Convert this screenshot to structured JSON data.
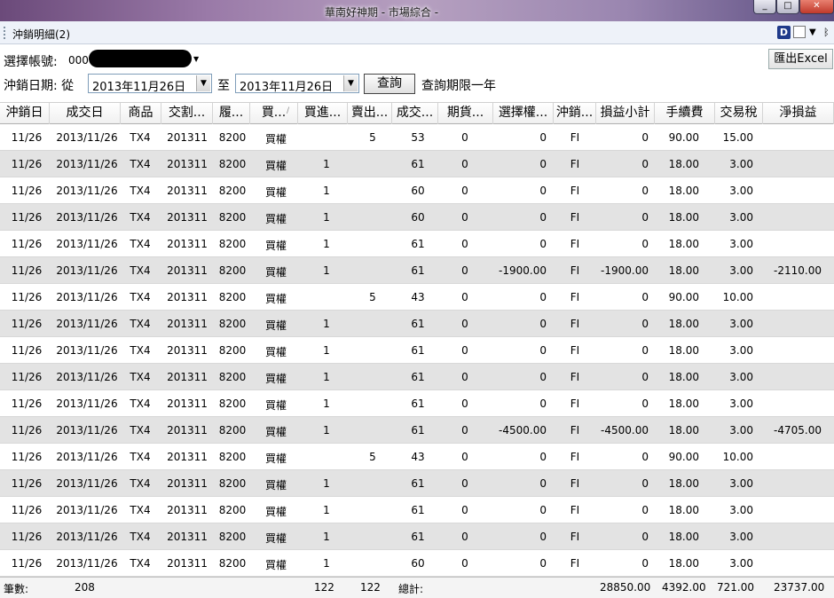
{
  "window": {
    "title": "華南好神期 - 市場綜合 -"
  },
  "panel": {
    "title": "沖銷明細(2)"
  },
  "form": {
    "account_label": "選擇帳號:",
    "account_value": "000",
    "excel_label": "匯出Excel",
    "date_label": "沖銷日期: 從",
    "date_from": "2013年11月26日",
    "to_label": "至",
    "date_to": "2013年11月26日",
    "query_label": "查詢",
    "query_limit": "查詢期限一年"
  },
  "columns": [
    "沖銷日",
    "成交日",
    "商品",
    "交割...",
    "履...",
    "買...",
    "買進...",
    "賣出...",
    "成交...",
    "期貨...",
    "選擇權...",
    "沖銷...",
    "損益小計",
    "手續費",
    "交易稅",
    "淨損益"
  ],
  "rows": [
    [
      "11/26",
      "2013/11/26",
      "TX4",
      "201311",
      "8200",
      "買權",
      "",
      "5",
      "53",
      "0",
      "0",
      "FI",
      "0",
      "90.00",
      "15.00",
      ""
    ],
    [
      "11/26",
      "2013/11/26",
      "TX4",
      "201311",
      "8200",
      "買權",
      "1",
      "",
      "61",
      "0",
      "0",
      "FI",
      "0",
      "18.00",
      "3.00",
      ""
    ],
    [
      "11/26",
      "2013/11/26",
      "TX4",
      "201311",
      "8200",
      "買權",
      "1",
      "",
      "60",
      "0",
      "0",
      "FI",
      "0",
      "18.00",
      "3.00",
      ""
    ],
    [
      "11/26",
      "2013/11/26",
      "TX4",
      "201311",
      "8200",
      "買權",
      "1",
      "",
      "60",
      "0",
      "0",
      "FI",
      "0",
      "18.00",
      "3.00",
      ""
    ],
    [
      "11/26",
      "2013/11/26",
      "TX4",
      "201311",
      "8200",
      "買權",
      "1",
      "",
      "61",
      "0",
      "0",
      "FI",
      "0",
      "18.00",
      "3.00",
      ""
    ],
    [
      "11/26",
      "2013/11/26",
      "TX4",
      "201311",
      "8200",
      "買權",
      "1",
      "",
      "61",
      "0",
      "-1900.00",
      "FI",
      "-1900.00",
      "18.00",
      "3.00",
      "-2110.00"
    ],
    [
      "11/26",
      "2013/11/26",
      "TX4",
      "201311",
      "8200",
      "買權",
      "",
      "5",
      "43",
      "0",
      "0",
      "FI",
      "0",
      "90.00",
      "10.00",
      ""
    ],
    [
      "11/26",
      "2013/11/26",
      "TX4",
      "201311",
      "8200",
      "買權",
      "1",
      "",
      "61",
      "0",
      "0",
      "FI",
      "0",
      "18.00",
      "3.00",
      ""
    ],
    [
      "11/26",
      "2013/11/26",
      "TX4",
      "201311",
      "8200",
      "買權",
      "1",
      "",
      "61",
      "0",
      "0",
      "FI",
      "0",
      "18.00",
      "3.00",
      ""
    ],
    [
      "11/26",
      "2013/11/26",
      "TX4",
      "201311",
      "8200",
      "買權",
      "1",
      "",
      "61",
      "0",
      "0",
      "FI",
      "0",
      "18.00",
      "3.00",
      ""
    ],
    [
      "11/26",
      "2013/11/26",
      "TX4",
      "201311",
      "8200",
      "買權",
      "1",
      "",
      "61",
      "0",
      "0",
      "FI",
      "0",
      "18.00",
      "3.00",
      ""
    ],
    [
      "11/26",
      "2013/11/26",
      "TX4",
      "201311",
      "8200",
      "買權",
      "1",
      "",
      "61",
      "0",
      "-4500.00",
      "FI",
      "-4500.00",
      "18.00",
      "3.00",
      "-4705.00"
    ],
    [
      "11/26",
      "2013/11/26",
      "TX4",
      "201311",
      "8200",
      "買權",
      "",
      "5",
      "43",
      "0",
      "0",
      "FI",
      "0",
      "90.00",
      "10.00",
      ""
    ],
    [
      "11/26",
      "2013/11/26",
      "TX4",
      "201311",
      "8200",
      "買權",
      "1",
      "",
      "61",
      "0",
      "0",
      "FI",
      "0",
      "18.00",
      "3.00",
      ""
    ],
    [
      "11/26",
      "2013/11/26",
      "TX4",
      "201311",
      "8200",
      "買權",
      "1",
      "",
      "61",
      "0",
      "0",
      "FI",
      "0",
      "18.00",
      "3.00",
      ""
    ],
    [
      "11/26",
      "2013/11/26",
      "TX4",
      "201311",
      "8200",
      "買權",
      "1",
      "",
      "61",
      "0",
      "0",
      "FI",
      "0",
      "18.00",
      "3.00",
      ""
    ],
    [
      "11/26",
      "2013/11/26",
      "TX4",
      "201311",
      "8200",
      "買權",
      "1",
      "",
      "60",
      "0",
      "0",
      "FI",
      "0",
      "18.00",
      "3.00",
      ""
    ]
  ],
  "footer": {
    "count_label": "筆數:",
    "count": "208",
    "buy_total": "122",
    "sell_total": "122",
    "total_label": "總計:",
    "pnl_total": "28850.00",
    "fee_total": "4392.00",
    "tax_total": "721.00",
    "net_total": "23737.00"
  }
}
